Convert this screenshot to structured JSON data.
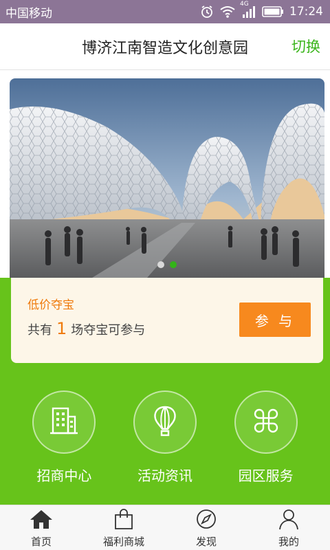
{
  "status_bar": {
    "carrier": "中国移动",
    "network": "4G",
    "time": "17:24",
    "icons": [
      "alarm-icon",
      "wifi-icon",
      "signal-icon",
      "battery-icon"
    ]
  },
  "header": {
    "title": "博济江南智造文化创意园",
    "switch_label": "切换"
  },
  "banner": {
    "slide_count": 2,
    "active_slide": 2
  },
  "promo": {
    "label": "低价夺宝",
    "prefix": "共有",
    "count": "1",
    "suffix": "场夺宝可参与",
    "button_label": "参 与"
  },
  "grid": {
    "items": [
      {
        "label": "招商中心",
        "icon": "building-icon"
      },
      {
        "label": "活动资讯",
        "icon": "balloon-icon"
      },
      {
        "label": "园区服务",
        "icon": "clover-icon"
      }
    ]
  },
  "bottom_nav": {
    "items": [
      {
        "label": "首页",
        "icon": "home-icon"
      },
      {
        "label": "福利商城",
        "icon": "shopping-bag-icon"
      },
      {
        "label": "发现",
        "icon": "compass-icon"
      },
      {
        "label": "我的",
        "icon": "user-icon"
      }
    ]
  },
  "colors": {
    "status_bar": "#8c7596",
    "accent_green": "#67c31b",
    "switch_green": "#3bb51c",
    "orange": "#f7891e",
    "card_bg": "#fdf6e8"
  }
}
